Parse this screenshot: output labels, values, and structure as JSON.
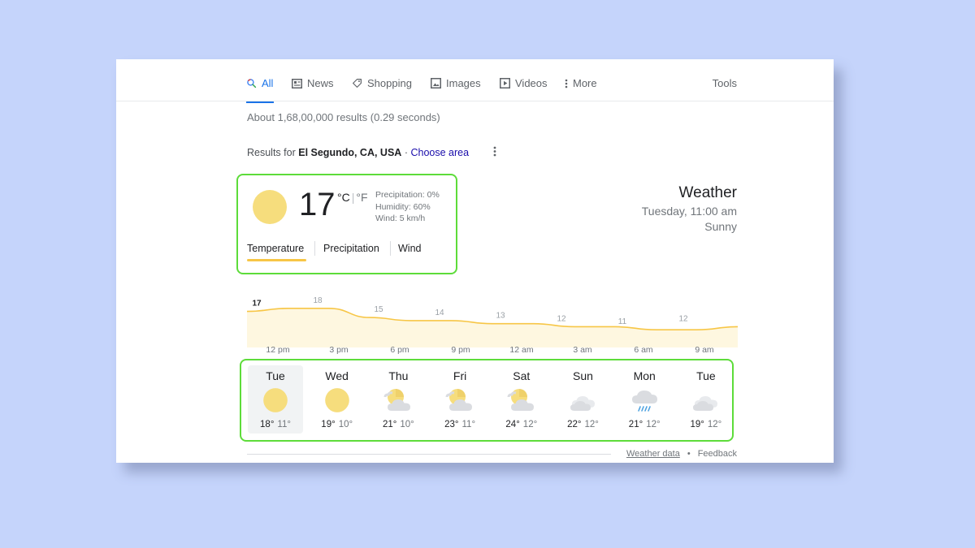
{
  "tabs": [
    {
      "label": "All",
      "icon": "search-icon"
    },
    {
      "label": "News",
      "icon": "news-icon"
    },
    {
      "label": "Shopping",
      "icon": "tag-icon"
    },
    {
      "label": "Images",
      "icon": "image-icon"
    },
    {
      "label": "Videos",
      "icon": "play-icon"
    },
    {
      "label": "More",
      "icon": "more-vertical-icon"
    }
  ],
  "tools_label": "Tools",
  "result_stats": "About 1,68,00,000 results (0.29 seconds)",
  "location": {
    "prefix": "Results for",
    "place": "El Segundo, CA, USA",
    "separator": "·",
    "choose_area": "Choose area"
  },
  "current": {
    "temp": "17",
    "unit_c": "°C",
    "unit_sep": "|",
    "unit_f": "°F",
    "precipitation": "Precipitation: 0%",
    "humidity": "Humidity: 60%",
    "wind": "Wind: 5 km/h"
  },
  "weather_tabs": [
    "Temperature",
    "Precipitation",
    "Wind"
  ],
  "header": {
    "title": "Weather",
    "time": "Tuesday, 11:00 am",
    "condition": "Sunny"
  },
  "chart_data": {
    "type": "area",
    "series": [
      {
        "values": [
          17,
          18,
          18,
          15,
          14,
          14,
          13,
          13,
          12,
          12,
          11,
          11,
          12
        ]
      }
    ],
    "point_labels": [
      "17",
      "18",
      "15",
      "14",
      "13",
      "12",
      "11",
      "12"
    ],
    "x_tick_labels": [
      "12 pm",
      "3 pm",
      "6 pm",
      "9 pm",
      "12 am",
      "3 am",
      "6 am",
      "9 am"
    ],
    "colors": {
      "line": "#f7c646",
      "fill": "#fef7e0"
    }
  },
  "hourly_times": [
    "12 pm",
    "3 pm",
    "6 pm",
    "9 pm",
    "12 am",
    "3 am",
    "6 am",
    "9 am"
  ],
  "days": [
    {
      "name": "Tue",
      "icon": "sun-icon",
      "high": "18°",
      "low": "11°"
    },
    {
      "name": "Wed",
      "icon": "sun-icon",
      "high": "19°",
      "low": "10°"
    },
    {
      "name": "Thu",
      "icon": "partly-cloudy-icon",
      "high": "21°",
      "low": "10°"
    },
    {
      "name": "Fri",
      "icon": "partly-cloudy-icon",
      "high": "23°",
      "low": "11°"
    },
    {
      "name": "Sat",
      "icon": "partly-cloudy-icon",
      "high": "24°",
      "low": "12°"
    },
    {
      "name": "Sun",
      "icon": "cloud-icon",
      "high": "22°",
      "low": "12°"
    },
    {
      "name": "Mon",
      "icon": "rain-icon",
      "high": "21°",
      "low": "12°"
    },
    {
      "name": "Tue",
      "icon": "cloud-icon",
      "high": "19°",
      "low": "12°"
    }
  ],
  "footer": {
    "weather_data": "Weather data",
    "separator": "•",
    "feedback": "Feedback"
  },
  "colors": {
    "accent": "#1a73e8",
    "sun": "#f6dd7d",
    "highlight_outline": "#5ddc3a",
    "temperature_underline": "#f7c646"
  }
}
